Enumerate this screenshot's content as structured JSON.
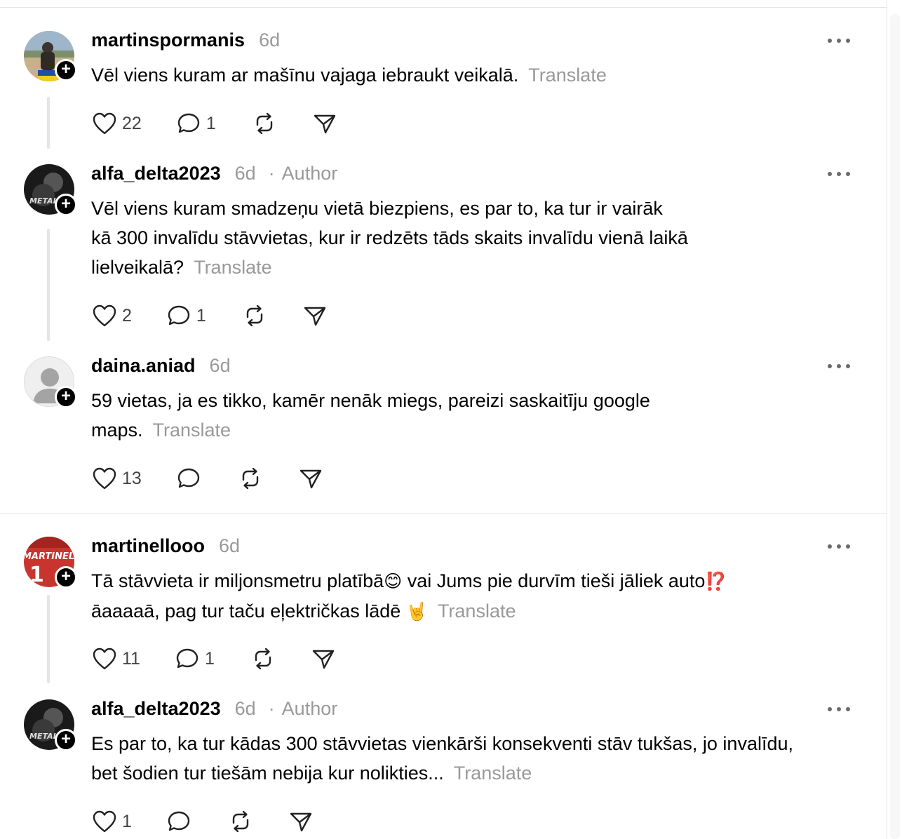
{
  "posts": [
    {
      "username": "martinspormanis",
      "time": "6d",
      "author_label": "",
      "lines": [
        "Vēl viens kuram ar mašīnu vajaga iebraukt veikalā."
      ],
      "translate": "Translate",
      "likes": "22",
      "replies": "1"
    },
    {
      "username": "alfa_delta2023",
      "time": "6d",
      "author_label": "Author",
      "lines": [
        "Vēl viens kuram smadzeņu vietā biezpiens, es par to, ka tur ir vairāk",
        "kā 300 invalīdu stāvvietas, kur ir redzēts tāds skaits invalīdu vienā laikā",
        "lielveikalā?"
      ],
      "translate": "Translate",
      "likes": "2",
      "replies": "1"
    },
    {
      "username": "daina.aniad",
      "time": "6d",
      "author_label": "",
      "lines": [
        "59 vietas, ja es tikko, kamēr nenāk miegs, pareizi saskaitīju google",
        "maps."
      ],
      "translate": "Translate",
      "likes": "13",
      "replies": ""
    },
    {
      "username": "martinellooo",
      "time": "6d",
      "author_label": "",
      "lines": [
        "Tā stāvvieta ir miljonsmetru platībā",
        "āaaaaā, pag tur taču eļektričkas lādē"
      ],
      "emoji_1": "😊",
      "line_1_rest": " vai Jums pie durvīm tieši jāliek auto",
      "emoji_2": "⁉️",
      "emoji_3": "🤘",
      "translate": "Translate",
      "likes": "11",
      "replies": "1"
    },
    {
      "username": "alfa_delta2023",
      "time": "6d",
      "author_label": "Author",
      "lines": [
        "Es par to, ka tur kādas 300 stāvvietas vienkārši konsekventi stāv tukšas, jo invalīdu,",
        "bet šodien tur tiešām nebija kur nolikties..."
      ],
      "translate": "Translate",
      "likes": "1",
      "replies": ""
    }
  ],
  "icons": {
    "like": "heart-icon",
    "reply": "speech-bubble-icon",
    "repost": "repost-icon",
    "share": "paper-plane-icon",
    "more": "more-dots-icon",
    "follow": "plus-icon"
  },
  "colors": {
    "text": "#000000",
    "muted": "#999999",
    "divider": "#e4e4e4"
  }
}
